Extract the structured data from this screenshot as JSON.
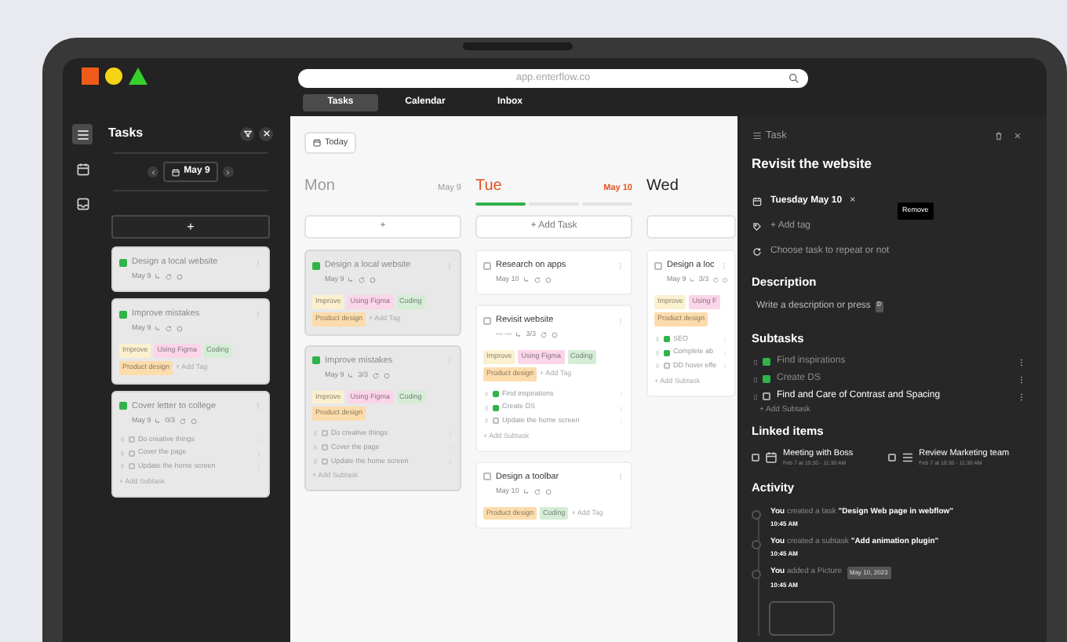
{
  "window": {
    "url": "app.enterflow.co"
  },
  "nav_tabs": [
    {
      "label": "Tasks",
      "selected": true
    },
    {
      "label": "Calendar",
      "selected": false
    },
    {
      "label": "Inbox",
      "selected": false
    }
  ],
  "sidebar_icons": [
    {
      "selected": true
    },
    {
      "selected": false
    },
    {
      "selected": false
    }
  ],
  "tasks_panel": {
    "title": "Tasks",
    "date": "May 9",
    "add_label": "+",
    "cards": [
      {
        "title": "Design a local website",
        "date": "May 9",
        "done": true
      },
      {
        "title": "Improve mistakes",
        "date": "May 9",
        "done": true,
        "tags": [
          {
            "label": "Improve",
            "color": "#fbf1cf"
          },
          {
            "label": "Using Figma",
            "color": "#fbd5e8"
          },
          {
            "label": "Coding",
            "color": "#d5edd6"
          },
          {
            "label": "Product design",
            "color": "#fcdcac"
          }
        ],
        "add_tag": "+ Add Tag"
      },
      {
        "title": "Cover letter to college",
        "date": "May 9",
        "count": "0/3",
        "done": true,
        "subtasks": [
          {
            "label": "Do creative things",
            "done": false
          },
          {
            "label": "Cover the page",
            "done": false
          },
          {
            "label": "Update the home screen",
            "done": false
          }
        ],
        "add_subtask": "+ Add Subtask"
      }
    ]
  },
  "board": {
    "today_label": "Today",
    "columns": [
      {
        "day": "Mon",
        "date": "May 9",
        "today": false,
        "add_label": "+",
        "cards": [
          {
            "title": "Design a local website",
            "date": "May 9",
            "done": true,
            "tags": [
              {
                "label": "Improve",
                "color": "#fbf1cf"
              },
              {
                "label": "Using Figma",
                "color": "#fbd5e8"
              },
              {
                "label": "Coding",
                "color": "#d5edd6"
              },
              {
                "label": "Product design",
                "color": "#fcdcac"
              }
            ],
            "add_tag": "+ Add Tag"
          },
          {
            "title": "Improve mistakes",
            "date": "May 9",
            "count": "3/3",
            "done": true,
            "tags": [
              {
                "label": "Improve",
                "color": "#fbf1cf"
              },
              {
                "label": "Using Figma",
                "color": "#fbd5e8"
              },
              {
                "label": "Coding",
                "color": "#d5edd6"
              },
              {
                "label": "Product design",
                "color": "#fcdcac"
              }
            ],
            "subtasks": [
              {
                "label": "Do creative things",
                "done": false
              },
              {
                "label": "Cover the page",
                "done": false
              },
              {
                "label": "Update the home screen",
                "done": false
              }
            ],
            "add_subtask": "+ Add Subtask"
          }
        ]
      },
      {
        "day": "Tue",
        "date": "May 10",
        "today": true,
        "segments": [
          {
            "done": true
          },
          {
            "done": false
          },
          {
            "done": false
          }
        ],
        "add_label": "+ Add Task",
        "cards": [
          {
            "title": "Research on apps",
            "date": "May 10",
            "done": false
          },
          {
            "title": "Revisit website",
            "date": "— —",
            "count": "3/3",
            "done": false,
            "tags": [
              {
                "label": "Improve",
                "color": "#fbf1cf"
              },
              {
                "label": "Using Figma",
                "color": "#fbd5e8"
              },
              {
                "label": "Coding",
                "color": "#d5edd6"
              },
              {
                "label": "Product design",
                "color": "#fcdcac"
              }
            ],
            "add_tag": "+ Add Tag",
            "subtasks": [
              {
                "label": "Find inspirations",
                "done": true
              },
              {
                "label": "Create DS",
                "done": true
              },
              {
                "label": "Update the home screen",
                "done": false
              }
            ],
            "add_subtask": "+ Add Subtask"
          },
          {
            "title": "Design a toolbar",
            "date": "May 10",
            "done": false,
            "tags": [
              {
                "label": "Product design",
                "color": "#fcdcac"
              },
              {
                "label": "Coding",
                "color": "#d5edd6"
              }
            ],
            "add_tag": "+ Add Tag"
          }
        ]
      },
      {
        "day": "Wed",
        "today": false,
        "cards": [
          {
            "title": "Design a loc",
            "date": "May 9",
            "count": "3/3",
            "done": false,
            "tags": [
              {
                "label": "Improve",
                "color": "#fbf1cf"
              },
              {
                "label": "Using F",
                "color": "#fbd5e8"
              },
              {
                "label": "Product design",
                "color": "#fcdcac"
              }
            ],
            "subtasks": [
              {
                "label": "SEO",
                "done": true
              },
              {
                "label": "Complete ab",
                "done": true
              },
              {
                "label": "DD hover effe",
                "done": false
              }
            ],
            "add_subtask": "+ Add Subtask"
          }
        ]
      }
    ]
  },
  "detail": {
    "header": "Task",
    "title": "Revisit the website",
    "date": "Tuesday May 10",
    "remove_mark": "×",
    "tooltip": "Remove",
    "add_tag": "+ Add tag",
    "repeat": "Choose task to repeat or not",
    "description_heading": "Description",
    "description_placeholder": "Write a description or press",
    "description_key": "D",
    "subtasks_heading": "Subtasks",
    "subtasks": [
      {
        "label": "Find inspirations",
        "done": true
      },
      {
        "label": "Create DS",
        "done": true
      },
      {
        "label": "Find and Care of Contrast and Spacing",
        "done": false
      }
    ],
    "add_subtask": "+ Add Subtask",
    "linked_heading": "Linked items",
    "linked": [
      {
        "kind": "event",
        "checked": false,
        "title": "Meeting with Boss",
        "time": "Feb 7 at 10:30 - 11:30 AM"
      },
      {
        "kind": "list",
        "checked": false,
        "title": "Review Marketing team",
        "time": "Feb 7 at 10:30 - 11:30 AM"
      }
    ],
    "activity_heading": "Activity",
    "activity": [
      {
        "kind": "text",
        "text": "**You** created a task **\"Design Web page in webflow\"**",
        "time": "10:45 AM"
      },
      {
        "kind": "text",
        "text": "**You** created a subtask **\"Add animation plugin\"**",
        "time": "10:45 AM"
      },
      {
        "kind": "picture",
        "text": "**You** added a Picture",
        "badge": "May 10, 2023",
        "time": "10:45 AM"
      }
    ]
  }
}
